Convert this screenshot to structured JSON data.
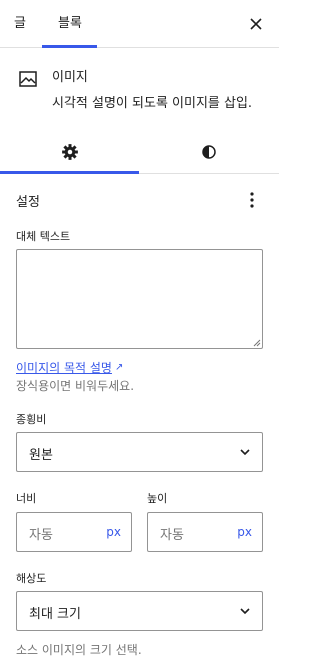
{
  "tabs": {
    "post_label": "글",
    "block_label": "블록"
  },
  "block_card": {
    "title": "이미지",
    "description": "시각적 설명이 되도록 이미지를 삽입."
  },
  "settings": {
    "section_title": "설정",
    "alt_text": {
      "label": "대체 텍스트",
      "value": ""
    },
    "alt_link": "이미지의 목적 설명",
    "alt_help": "장식용이면 비워두세요.",
    "aspect_ratio": {
      "label": "종횡비",
      "value": "원본"
    },
    "width": {
      "label": "너비",
      "placeholder": "자동",
      "unit": "px"
    },
    "height": {
      "label": "높이",
      "placeholder": "자동",
      "unit": "px"
    },
    "resolution": {
      "label": "해상도",
      "value": "최대 크기",
      "help": "소스 이미지의 크기 선택."
    }
  },
  "colors": {
    "accent": "#3858e9",
    "border": "#949494",
    "muted": "#757575"
  }
}
